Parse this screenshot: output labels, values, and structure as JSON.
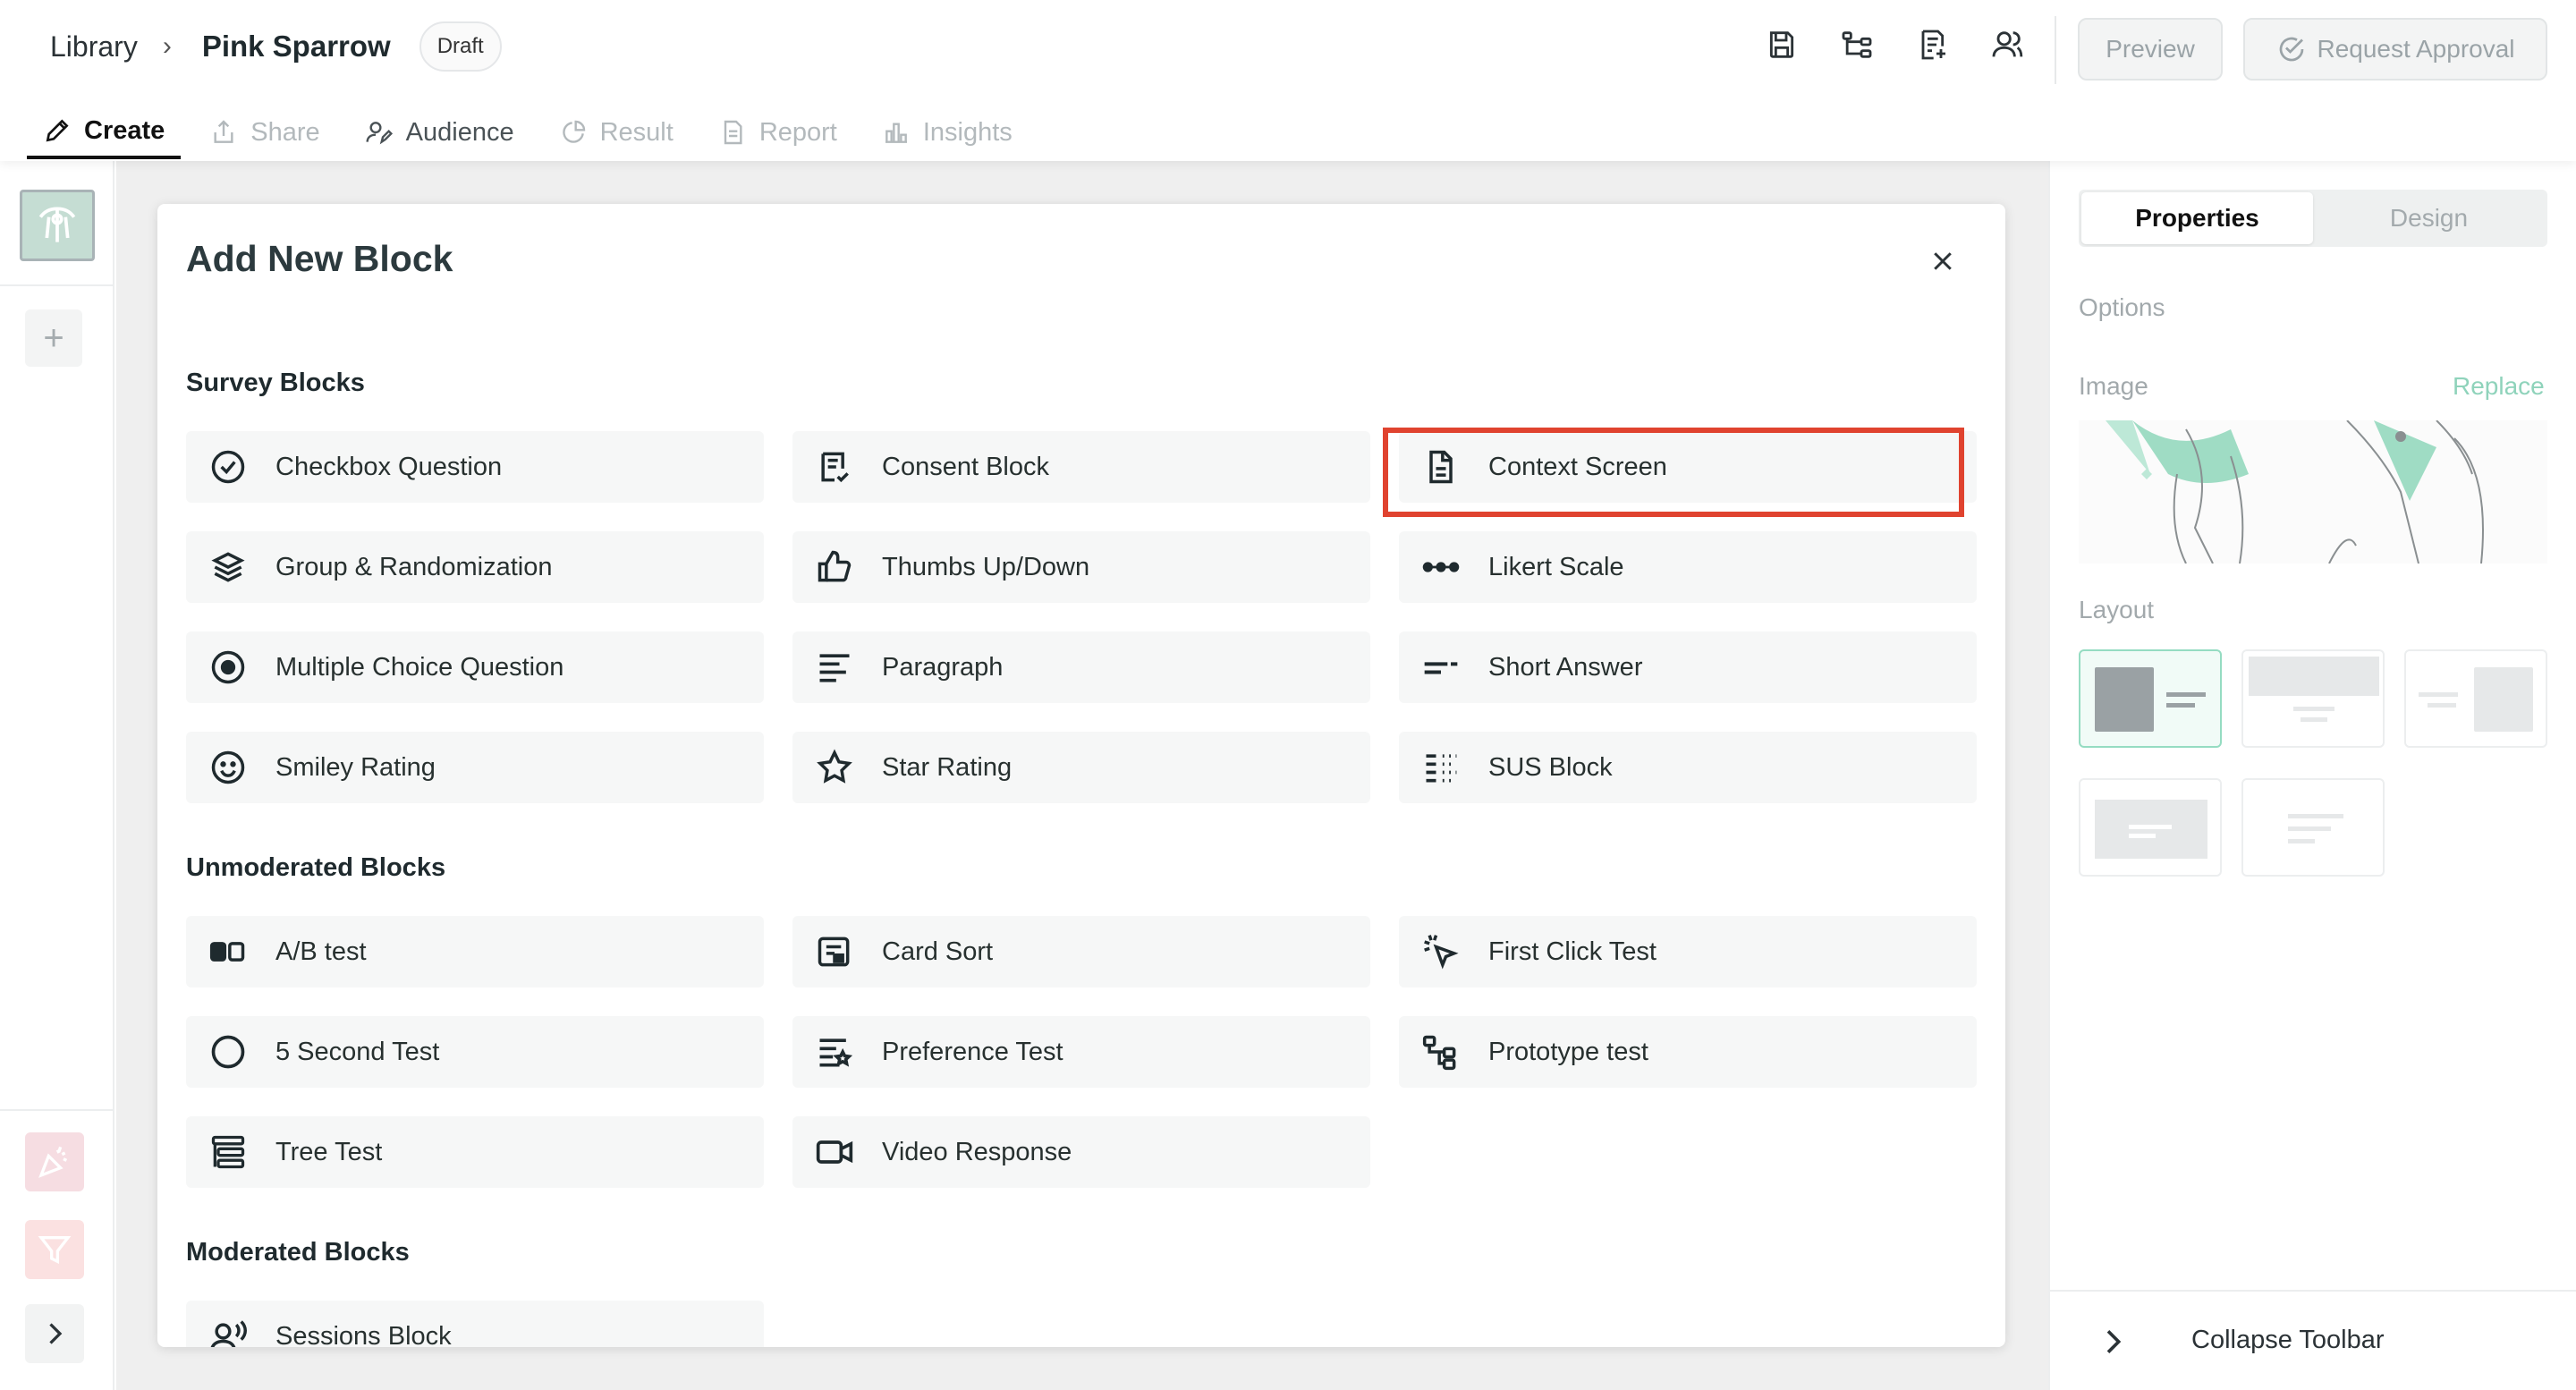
{
  "header": {
    "breadcrumb_root": "Library",
    "breadcrumb_sep": "›",
    "project_title": "Pink Sparrow",
    "status_badge": "Draft",
    "preview_label": "Preview",
    "request_approval_label": "Request Approval",
    "icons": [
      "save-icon",
      "flow-icon",
      "add-note-icon",
      "users-icon"
    ]
  },
  "tabs": [
    {
      "label": "Create",
      "icon": "pencil-icon"
    },
    {
      "label": "Share",
      "icon": "share-icon"
    },
    {
      "label": "Audience",
      "icon": "audience-icon"
    },
    {
      "label": "Result",
      "icon": "pie-icon"
    },
    {
      "label": "Report",
      "icon": "document-icon"
    },
    {
      "label": "Insights",
      "icon": "bar-chart-icon"
    }
  ],
  "rail": {
    "add_label": "+"
  },
  "modal": {
    "title": "Add New Block",
    "sections": {
      "survey": {
        "title": "Survey Blocks",
        "items": [
          {
            "label": "Checkbox Question",
            "icon": "check-circle-icon"
          },
          {
            "label": "Consent Block",
            "icon": "consent-icon"
          },
          {
            "label": "Context Screen",
            "icon": "context-document-icon"
          },
          {
            "label": "Group & Randomization",
            "icon": "layers-icon"
          },
          {
            "label": "Thumbs Up/Down",
            "icon": "thumbs-up-icon"
          },
          {
            "label": "Likert Scale",
            "icon": "dots-scale-icon"
          },
          {
            "label": "Multiple Choice Question",
            "icon": "radio-icon"
          },
          {
            "label": "Paragraph",
            "icon": "paragraph-icon"
          },
          {
            "label": "Short Answer",
            "icon": "short-answer-icon"
          },
          {
            "label": "Smiley Rating",
            "icon": "smiley-icon"
          },
          {
            "label": "Star Rating",
            "icon": "star-icon"
          },
          {
            "label": "SUS Block",
            "icon": "sus-list-icon"
          }
        ]
      },
      "unmoderated": {
        "title": "Unmoderated Blocks",
        "items": [
          {
            "label": "A/B test",
            "icon": "ab-icon"
          },
          {
            "label": "Card Sort",
            "icon": "card-sort-icon"
          },
          {
            "label": "First Click Test",
            "icon": "cursor-click-icon"
          },
          {
            "label": "5 Second Test",
            "icon": "circle-icon"
          },
          {
            "label": "Preference Test",
            "icon": "preference-icon"
          },
          {
            "label": "Prototype test",
            "icon": "prototype-icon"
          },
          {
            "label": "Tree Test",
            "icon": "tree-icon"
          },
          {
            "label": "Video Response",
            "icon": "video-icon"
          }
        ]
      },
      "moderated": {
        "title": "Moderated Blocks",
        "items": [
          {
            "label": "Sessions Block",
            "icon": "session-user-icon"
          }
        ]
      }
    },
    "highlighted_item": "Context Screen",
    "highlight_color": "#e0432f"
  },
  "panel": {
    "tab_properties": "Properties",
    "tab_design": "Design",
    "options_label": "Options",
    "image_label": "Image",
    "replace_label": "Replace",
    "layout_label": "Layout",
    "collapse_label": "Collapse Toolbar",
    "accent_color": "#8fd3bb"
  }
}
